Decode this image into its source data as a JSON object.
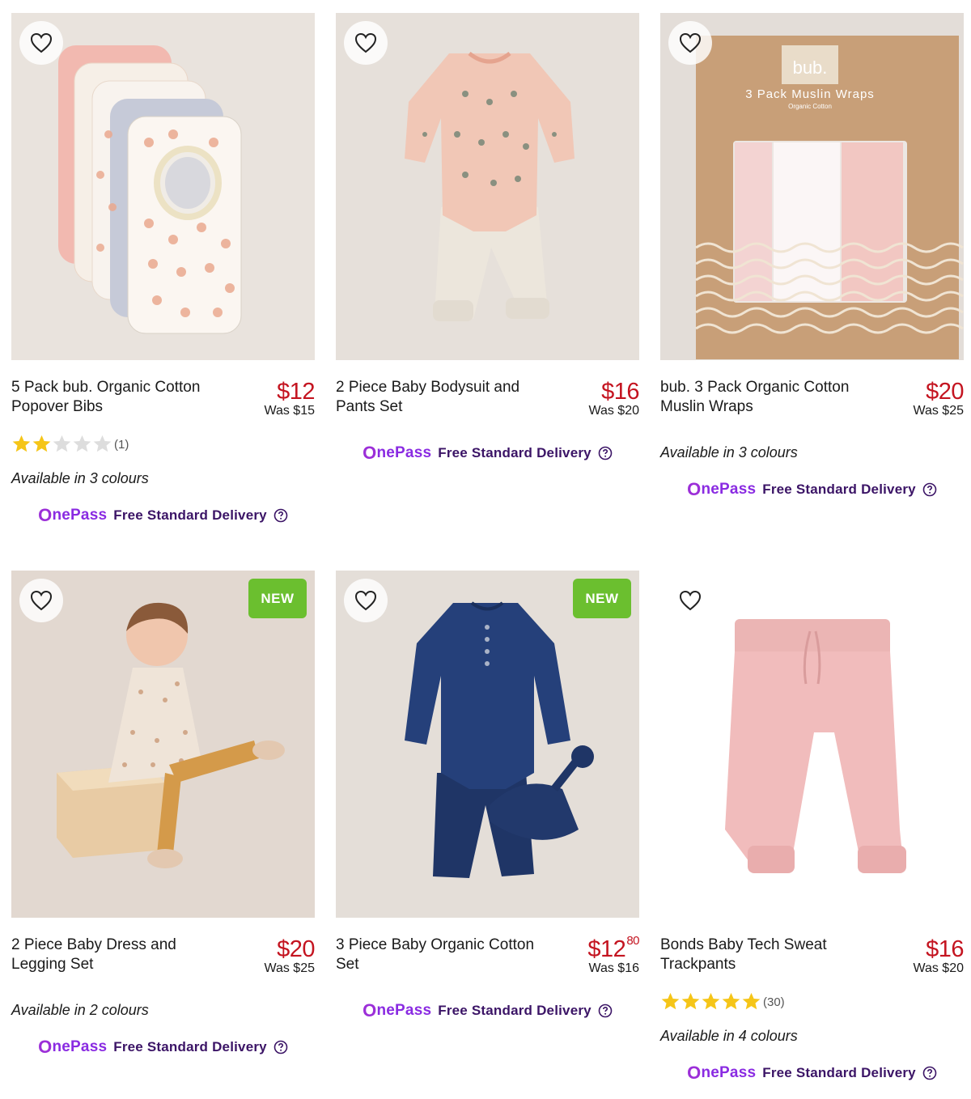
{
  "products": [
    {
      "name": "5 Pack bub. Organic Cotton Popover Bibs",
      "price": "$12",
      "price_cents": "",
      "was": "Was $15",
      "rating": 2,
      "rating_count": "(1)",
      "colours": "Available in 3 colours",
      "badge": "",
      "image_bg": "#e9e3dd",
      "delivery_brand": "OnePass",
      "delivery_text": "Free Standard Delivery"
    },
    {
      "name": "2 Piece Baby Bodysuit and Pants Set",
      "price": "$16",
      "price_cents": "",
      "was": "Was $20",
      "rating": null,
      "rating_count": "",
      "colours": "",
      "badge": "",
      "image_bg": "#e6e0da",
      "delivery_brand": "OnePass",
      "delivery_text": "Free Standard Delivery"
    },
    {
      "name": "bub. 3 Pack Organic Cotton Muslin Wraps",
      "price": "$20",
      "price_cents": "",
      "was": "Was $25",
      "rating": null,
      "rating_count": "",
      "colours": "Available in 3 colours",
      "badge": "",
      "image_bg": "#e3ddd8",
      "delivery_brand": "OnePass",
      "delivery_text": "Free Standard Delivery"
    },
    {
      "name": "2 Piece Baby Dress and Legging Set",
      "price": "$20",
      "price_cents": "",
      "was": "Was $25",
      "rating": null,
      "rating_count": "",
      "colours": "Available in 2 colours",
      "badge": "NEW",
      "image_bg": "#e2d8d0",
      "delivery_brand": "OnePass",
      "delivery_text": "Free Standard Delivery"
    },
    {
      "name": "3 Piece Baby Organic Cotton Set",
      "price": "$12",
      "price_cents": "80",
      "was": "Was $16",
      "rating": null,
      "rating_count": "",
      "colours": "",
      "badge": "NEW",
      "image_bg": "#e4ded8",
      "delivery_brand": "OnePass",
      "delivery_text": "Free Standard Delivery"
    },
    {
      "name": "Bonds Baby Tech Sweat Trackpants",
      "price": "$16",
      "price_cents": "",
      "was": "Was $20",
      "rating": 5,
      "rating_count": "(30)",
      "colours": "Available in 4 colours",
      "badge": "",
      "image_bg": "#ffffff",
      "delivery_brand": "OnePass",
      "delivery_text": "Free Standard Delivery"
    }
  ],
  "muslin_box": {
    "brand": "bub.",
    "title": "3 Pack Muslin Wraps",
    "subtitle": "Organic Cotton"
  },
  "colors": {
    "price_red": "#c41420",
    "onepass_purple": "#9c2fd8",
    "delivery_text": "#3b1466",
    "new_badge": "#6bbf2f",
    "star_gold": "#f5c518",
    "star_empty": "#dddddd"
  }
}
